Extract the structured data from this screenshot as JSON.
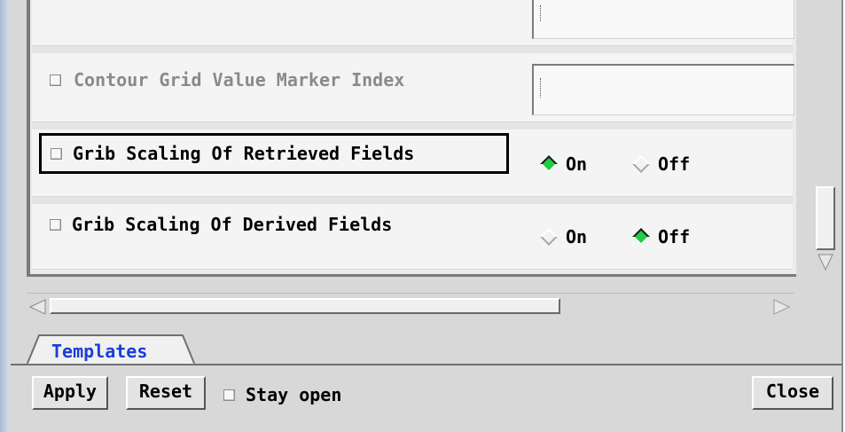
{
  "options": {
    "top_partial": {
      "name": "",
      "value": ""
    },
    "contour_marker": {
      "label": "Contour Grid Value Marker Index",
      "value": ""
    },
    "grib_retrieved": {
      "label": "Grib Scaling Of Retrieved Fields",
      "on_label": "On",
      "off_label": "Off",
      "selected": "On"
    },
    "grib_derived": {
      "label": "Grib Scaling Of Derived Fields",
      "on_label": "On",
      "off_label": "Off",
      "selected": "Off"
    }
  },
  "tabs": [
    {
      "label": "Templates",
      "active": true
    }
  ],
  "footer": {
    "apply": "Apply",
    "reset": "Reset",
    "stay_open": "Stay open",
    "close": "Close"
  },
  "colors": {
    "selected_radio": "#22cc44",
    "tab_text": "#1a3dd8",
    "focus_border": "#000000"
  }
}
